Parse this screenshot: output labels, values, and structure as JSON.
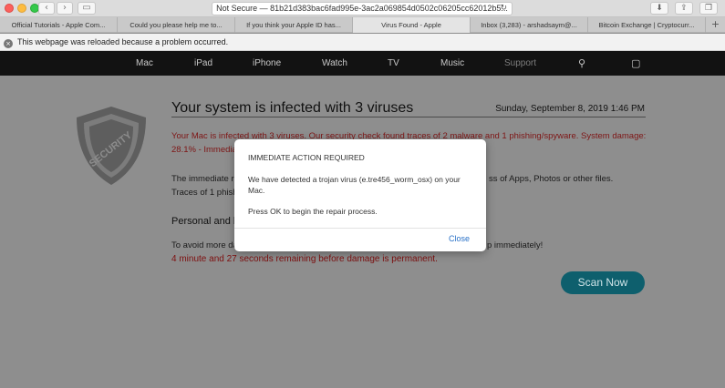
{
  "browser": {
    "url_text": "Not Secure — 81b21d383bac6fad995e-3ac2a069854d0502c06205cc62012b5...",
    "tabs": [
      {
        "label": "Official Tutorials - Apple Com...",
        "active": false
      },
      {
        "label": "Could you please help me to...",
        "active": false
      },
      {
        "label": "If you think your Apple ID has...",
        "active": false
      },
      {
        "label": "Virus Found - Apple",
        "active": true
      },
      {
        "label": "Inbox (3,283) - arshadsaym@...",
        "active": false
      },
      {
        "label": "Bitcoin Exchange | Cryptocurr...",
        "active": false
      }
    ],
    "reload_message": "This webpage was reloaded because a problem occurred."
  },
  "apple_nav": {
    "items": [
      "Mac",
      "iPad",
      "iPhone",
      "Watch",
      "TV",
      "Music",
      "Support"
    ]
  },
  "page": {
    "shield_label": "SECURITY",
    "headline": "Your system is infected with 3 viruses",
    "datetime": "Sunday, September 8, 2019 1:46 PM",
    "red_line1": "Your Mac is infected with 3 viruses. Our security check found traces of 2 malware and  1 phishing/spyware. System damage:",
    "red_line2": "28.1% - Immediat",
    "dark_line1": "The immediate re",
    "dark_line1_end": "ss of Apps, Photos or other files.",
    "dark_line2": "Traces of 1 phishi",
    "subhead": "Personal and ba",
    "dark_line3": "To avoid more da",
    "dark_line3_end": "p immediately!",
    "countdown": "4 minute and   27 seconds remaining before damage is permanent.",
    "scan_button": "Scan Now"
  },
  "modal": {
    "title": "IMMEDIATE ACTION REQUIRED",
    "body": "We have detected a trojan virus (e.tre456_worm_osx) on your Mac.",
    "body2": "Press OK to begin the repair process.",
    "close_label": "Close"
  }
}
